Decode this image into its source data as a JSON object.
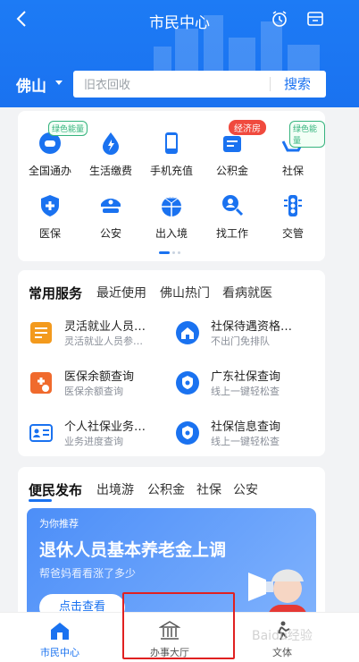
{
  "header": {
    "title": "市民中心",
    "city": "佛山",
    "search_placeholder": "旧衣回收",
    "search_button": "搜索",
    "accent": "#1a72f0"
  },
  "services": [
    {
      "label": "全国通办",
      "icon": "gamepad-icon",
      "tag": "绿色能量"
    },
    {
      "label": "生活缴费",
      "icon": "bolt-drop-icon",
      "tag": ""
    },
    {
      "label": "手机充值",
      "icon": "phone-icon",
      "tag": ""
    },
    {
      "label": "公积金",
      "icon": "fund-icon",
      "tag": "经济房"
    },
    {
      "label": "社保",
      "icon": "hands-heart-icon",
      "tag": "绿色能量"
    },
    {
      "label": "医保",
      "icon": "medical-shield-icon",
      "tag": ""
    },
    {
      "label": "公安",
      "icon": "police-cap-icon",
      "tag": ""
    },
    {
      "label": "出入境",
      "icon": "airplane-globe-icon",
      "tag": ""
    },
    {
      "label": "找工作",
      "icon": "job-search-icon",
      "tag": ""
    },
    {
      "label": "交管",
      "icon": "traffic-light-icon",
      "tag": ""
    }
  ],
  "common_tabs": [
    "常用服务",
    "最近使用",
    "佛山热门",
    "看病就医"
  ],
  "common_items": [
    {
      "name": "灵活就业人员…",
      "sub": "灵活就业人员参…",
      "icon": "document-icon"
    },
    {
      "name": "社保待遇资格…",
      "sub": "不出门免排队",
      "icon": "home-icon"
    },
    {
      "name": "医保余额查询",
      "sub": "医保余额查询",
      "icon": "medical-doc-icon"
    },
    {
      "name": "广东社保查询",
      "sub": "线上一键轻松查",
      "icon": "shield-search-icon"
    },
    {
      "name": "个人社保业务…",
      "sub": "业务进度查询",
      "icon": "id-card-icon"
    },
    {
      "name": "社保信息查询",
      "sub": "线上一键轻松查",
      "icon": "shield-search-icon"
    }
  ],
  "pub_tabs": [
    "便民发布",
    "出境游",
    "公积金",
    "社保",
    "公安"
  ],
  "banner": {
    "tag": "为你推荐",
    "title": "退休人员基本养老金上调",
    "subtitle": "帮爸妈看看涨了多少",
    "button": "点击查看"
  },
  "nav": [
    {
      "label": "市民中心",
      "icon": "home-icon"
    },
    {
      "label": "办事大厅",
      "icon": "government-building-icon"
    },
    {
      "label": "文体",
      "icon": "sports-icon"
    }
  ],
  "watermark": "Baidu经验"
}
